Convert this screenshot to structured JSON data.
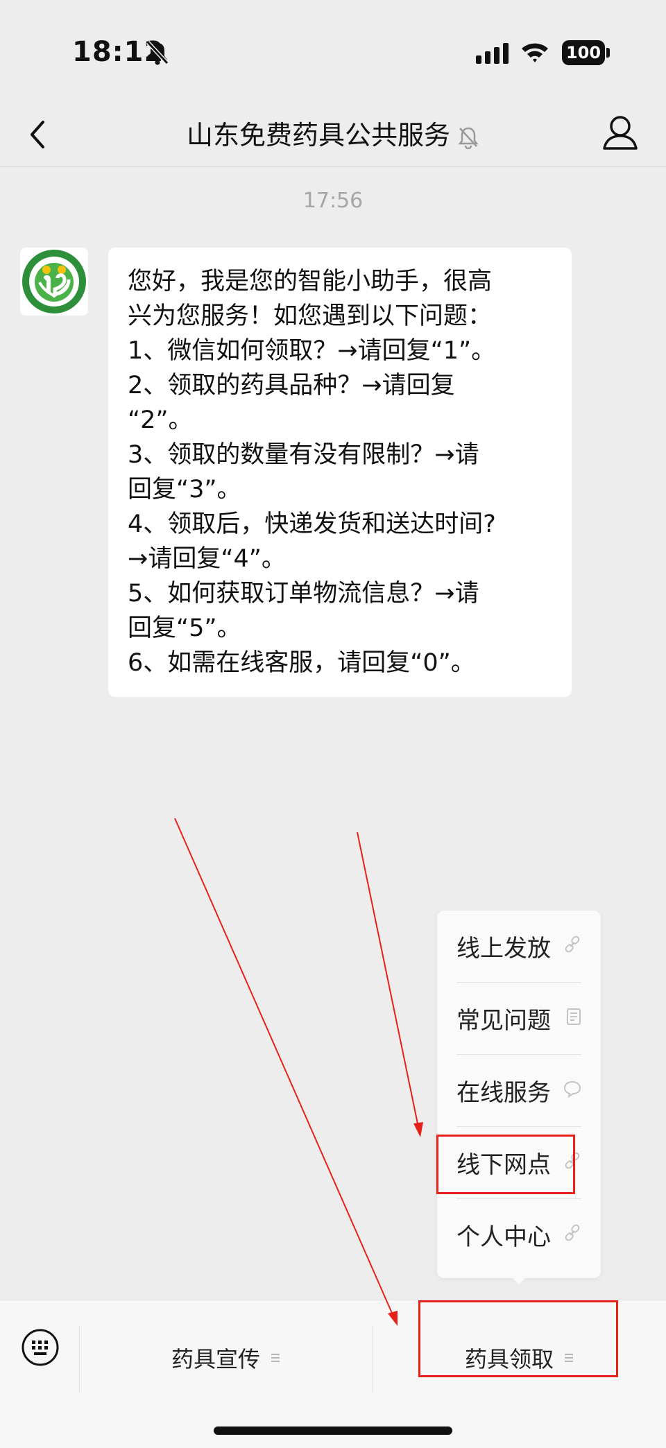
{
  "status_bar": {
    "time": "18:12",
    "battery": "100"
  },
  "nav": {
    "title": "山东免费药具公共服务"
  },
  "chat": {
    "timestamp": "17:56",
    "message_lines": [
      "您好，我是您的智能小助手，很高",
      "兴为您服务！如您遇到以下问题：",
      "1、微信如何领取？→请回复“1”。",
      "2、领取的药具品种？→请回复",
      "“2”。",
      "3、领取的数量有没有限制？→请",
      "回复“3”。",
      "4、领取后，快递发货和送达时间?",
      "→请回复“4”。",
      "5、如何获取订单物流信息？→请",
      "回复“5”。",
      "6、如需在线客服，请回复“0”。"
    ]
  },
  "popup_menu": {
    "items": [
      {
        "label": "线上发放",
        "icon": "link-icon"
      },
      {
        "label": "常见问题",
        "icon": "article-icon"
      },
      {
        "label": "在线服务",
        "icon": "chat-bubble-icon"
      },
      {
        "label": "线下网点",
        "icon": "link-icon"
      },
      {
        "label": "个人中心",
        "icon": "link-icon"
      }
    ]
  },
  "bottom_menu": {
    "tab1": "药具宣传",
    "tab2": "药具领取"
  },
  "annotation_color": "#e8201a"
}
